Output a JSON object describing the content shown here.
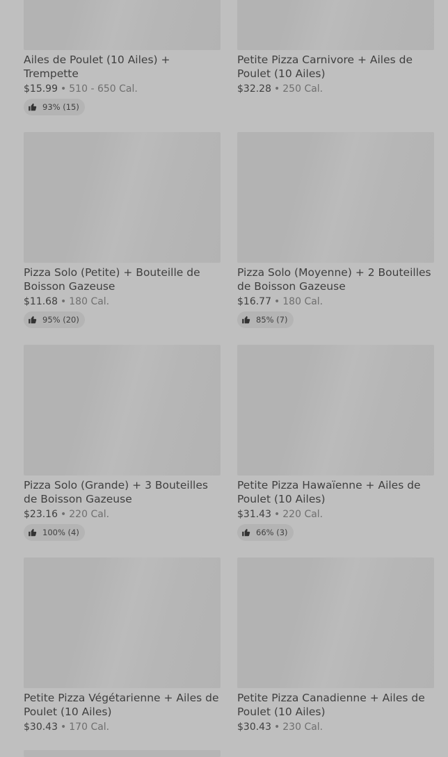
{
  "items": [
    {
      "name": "Ailes de Poulet (10 Ailes) + Trempette",
      "price": "$15.99",
      "separator": "•",
      "calories": "510 - 650 Cal.",
      "rating": "93% (15)"
    },
    {
      "name": "Petite Pizza Carnivore + Ailes de Poulet (10 Ailes)",
      "price": "$32.28",
      "separator": "•",
      "calories": "250 Cal.",
      "rating": ""
    },
    {
      "name": "Pizza Solo (Petite) + Bouteille de Boisson Gazeuse",
      "price": "$11.68",
      "separator": "•",
      "calories": "180 Cal.",
      "rating": "95% (20)"
    },
    {
      "name": "Pizza Solo (Moyenne) + 2 Bouteilles de Boisson Gazeuse",
      "price": "$16.77",
      "separator": "•",
      "calories": "180 Cal.",
      "rating": "85% (7)"
    },
    {
      "name": "Pizza Solo (Grande) + 3 Bouteilles de Boisson Gazeuse",
      "price": "$23.16",
      "separator": "•",
      "calories": "220 Cal.",
      "rating": "100% (4)"
    },
    {
      "name": "Petite Pizza Hawaïenne + Ailes de Poulet (10 Ailes)",
      "price": "$31.43",
      "separator": "•",
      "calories": "220 Cal.",
      "rating": "66% (3)"
    },
    {
      "name": "Petite Pizza Végétarienne + Ailes de Poulet (10 Ailes)",
      "price": "$30.43",
      "separator": "•",
      "calories": "170 Cal.",
      "rating": ""
    },
    {
      "name": "Petite Pizza Canadienne + Ailes de Poulet (10 Ailes)",
      "price": "$30.43",
      "separator": "•",
      "calories": "230 Cal.",
      "rating": ""
    }
  ],
  "icons": {
    "rating": "thumbs-up-icon"
  }
}
